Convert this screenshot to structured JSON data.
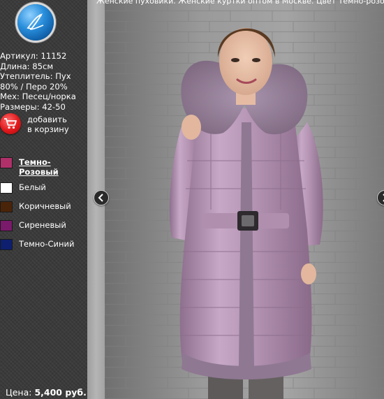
{
  "header": {
    "caption": "Женские пуховики. Женские куртки оптом в Москве. Цвет Темно-розовый"
  },
  "product": {
    "article": "Артикул: 11152",
    "length": "Длина: 85см",
    "insulation_line1": "Утеплитель: Пух",
    "insulation_line2": "80% / Перо 20%",
    "fur": "Мех: Песец/норка",
    "sizes": "Размеры: 42-50"
  },
  "cart": {
    "line1": "добавить",
    "line2": "в корзину"
  },
  "colors": [
    {
      "label": "Темно-Розовый",
      "hex": "#b0306a",
      "selected": true
    },
    {
      "label": "Белый",
      "hex": "#ffffff",
      "selected": false
    },
    {
      "label": "Коричневый",
      "hex": "#4a2408",
      "selected": false
    },
    {
      "label": "Сиреневый",
      "hex": "#7a1a6a",
      "selected": false
    },
    {
      "label": "Темно-Синий",
      "hex": "#0d1f6e",
      "selected": false
    }
  ],
  "price": {
    "label": "Цена:",
    "value": "5,400 руб."
  },
  "icons": {
    "logo": "brand-logo-icon",
    "cart": "shopping-cart-icon",
    "prev": "chevron-left-icon",
    "next": "chevron-right-icon"
  }
}
